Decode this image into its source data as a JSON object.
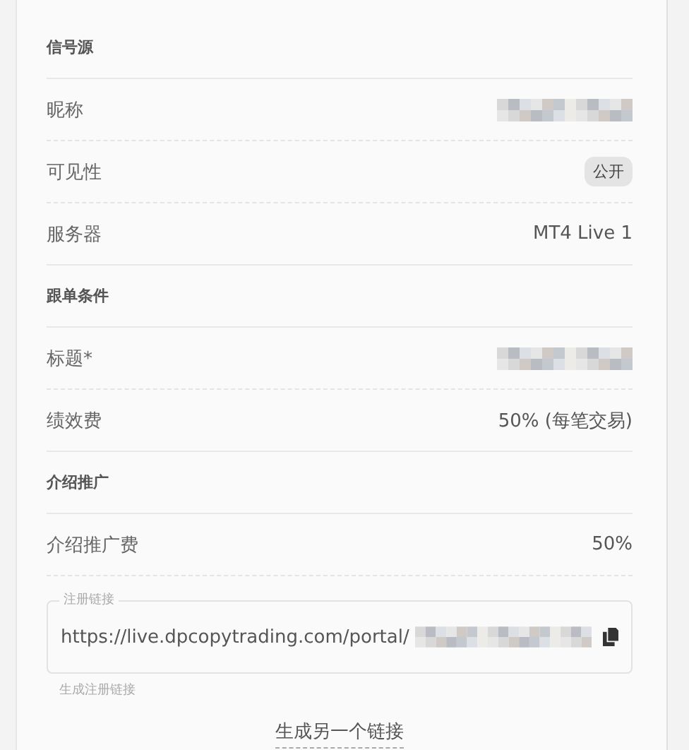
{
  "sections": [
    {
      "title": "信号源",
      "rows": [
        {
          "label": "昵称",
          "value": {
            "kind": "redacted"
          }
        },
        {
          "label": "可见性",
          "value": {
            "kind": "badge",
            "text": "公开"
          }
        },
        {
          "label": "服务器",
          "value": {
            "kind": "text",
            "text": "MT4 Live 1"
          }
        }
      ]
    },
    {
      "title": "跟单条件",
      "rows": [
        {
          "label": "标题*",
          "value": {
            "kind": "redacted"
          }
        },
        {
          "label": "绩效费",
          "value": {
            "kind": "text",
            "text": "50% (每笔交易)"
          }
        }
      ]
    },
    {
      "title": "介绍推广",
      "rows": [
        {
          "label": "介绍推广费",
          "value": {
            "kind": "text",
            "text": "50%"
          }
        }
      ]
    }
  ],
  "link_field": {
    "label": "注册链接",
    "value": "https://live.dpcopytrading.com/portal/",
    "helper": "生成注册链接"
  },
  "action_link": "生成另一个链接"
}
